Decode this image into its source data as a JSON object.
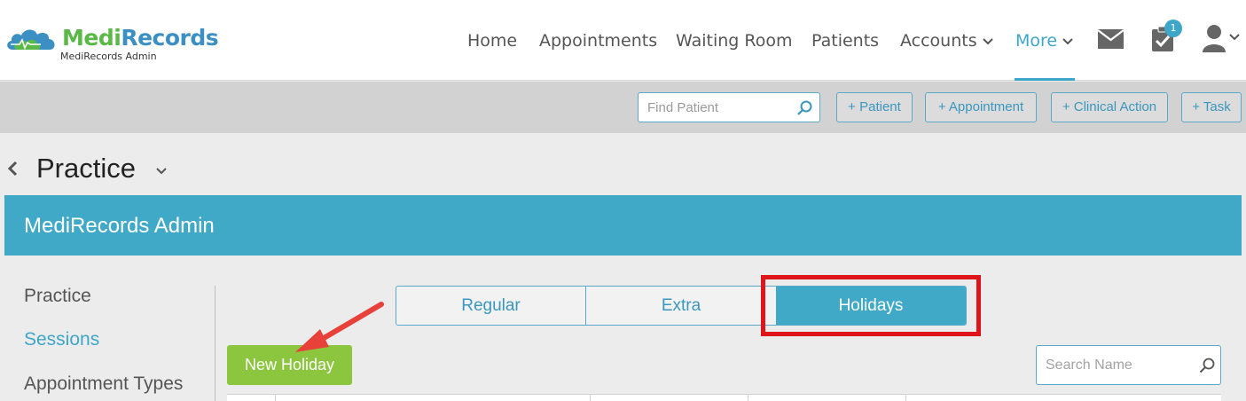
{
  "app": {
    "logo_medi": "Medi",
    "logo_records": "Records",
    "logo_subtitle": "MediRecords Admin"
  },
  "nav": {
    "items": [
      {
        "label": "Home"
      },
      {
        "label": "Appointments"
      },
      {
        "label": "Waiting Room"
      },
      {
        "label": "Patients"
      },
      {
        "label": "Accounts"
      },
      {
        "label": "More"
      }
    ],
    "active": "More",
    "tasks_badge": "1"
  },
  "toolbar": {
    "find_patient_placeholder": "Find Patient",
    "buttons": [
      {
        "label": "+ Patient"
      },
      {
        "label": "+ Appointment"
      },
      {
        "label": "+ Clinical Action"
      },
      {
        "label": "+ Task"
      }
    ]
  },
  "page": {
    "title": "Practice"
  },
  "panel": {
    "title": "MediRecords Admin"
  },
  "sidebar": {
    "items": [
      {
        "label": "Practice"
      },
      {
        "label": "Sessions"
      },
      {
        "label": "Appointment Types"
      }
    ],
    "active": "Sessions"
  },
  "tabs": {
    "items": [
      {
        "label": "Regular"
      },
      {
        "label": "Extra"
      },
      {
        "label": "Holidays"
      }
    ],
    "active": "Holidays"
  },
  "actions": {
    "new_holiday_label": "New Holiday",
    "search_name_placeholder": "Search Name"
  },
  "colors": {
    "accent": "#41a9c8",
    "logo_green": "#5ab946",
    "logo_blue": "#3b8fc2",
    "primary_button": "#8cc63f",
    "highlight": "#e0151b"
  }
}
